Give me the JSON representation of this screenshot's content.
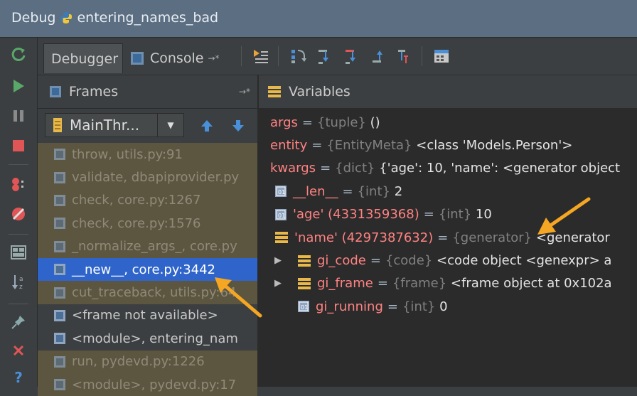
{
  "window": {
    "title_prefix": "Debug",
    "title": "entering_names_bad"
  },
  "tabs": [
    {
      "label": "Debugger"
    },
    {
      "label": "Console",
      "suffix": "→*"
    }
  ],
  "frames_panel": {
    "title": "Frames",
    "pin": "→*",
    "thread": "MainThr...",
    "items": [
      {
        "label": "throw, utils.py:91",
        "state": "library"
      },
      {
        "label": "validate, dbapiprovider.py",
        "state": "library"
      },
      {
        "label": "check, core.py:1267",
        "state": "library"
      },
      {
        "label": "check, core.py:1576",
        "state": "library"
      },
      {
        "label": "_normalize_args_, core.py",
        "state": "library"
      },
      {
        "label": "__new__, core.py:3442",
        "state": "selected"
      },
      {
        "label": "cut_traceback, utils.py:64",
        "state": "library"
      },
      {
        "label": "<frame not available>",
        "state": "plain"
      },
      {
        "label": "<module>, entering_nam",
        "state": "plain"
      },
      {
        "label": "run, pydevd.py:1226",
        "state": "library"
      },
      {
        "label": "<module>, pydevd.py:17",
        "state": "library"
      }
    ]
  },
  "variables_panel": {
    "title": "Variables",
    "rows": [
      {
        "name": "args",
        "type": "{tuple}",
        "value": "()"
      },
      {
        "name": "entity",
        "type": "{EntityMeta}",
        "value": "<class 'Models.Person'>"
      },
      {
        "name": "kwargs",
        "type": "{dict}",
        "value": "{'age': 10, 'name': <generator object"
      },
      {
        "name": "__len__",
        "type": "{int}",
        "value": "2"
      },
      {
        "name": "'age' (4331359368)",
        "type": "{int}",
        "value": "10"
      },
      {
        "name": "'name' (4297387632)",
        "type": "{generator}",
        "value": "<generator"
      },
      {
        "name": "gi_code",
        "type": "{code}",
        "value": "<code object <genexpr> a"
      },
      {
        "name": "gi_frame",
        "type": "{frame}",
        "value": "<frame object at 0x102a"
      },
      {
        "name": "gi_running",
        "type": "{int}",
        "value": "0"
      }
    ]
  },
  "colors": {
    "selection": "#2f65ca",
    "library_frame": "#5c5540",
    "var_name": "#ff8282",
    "annotation_arrow": "#f5a623"
  }
}
